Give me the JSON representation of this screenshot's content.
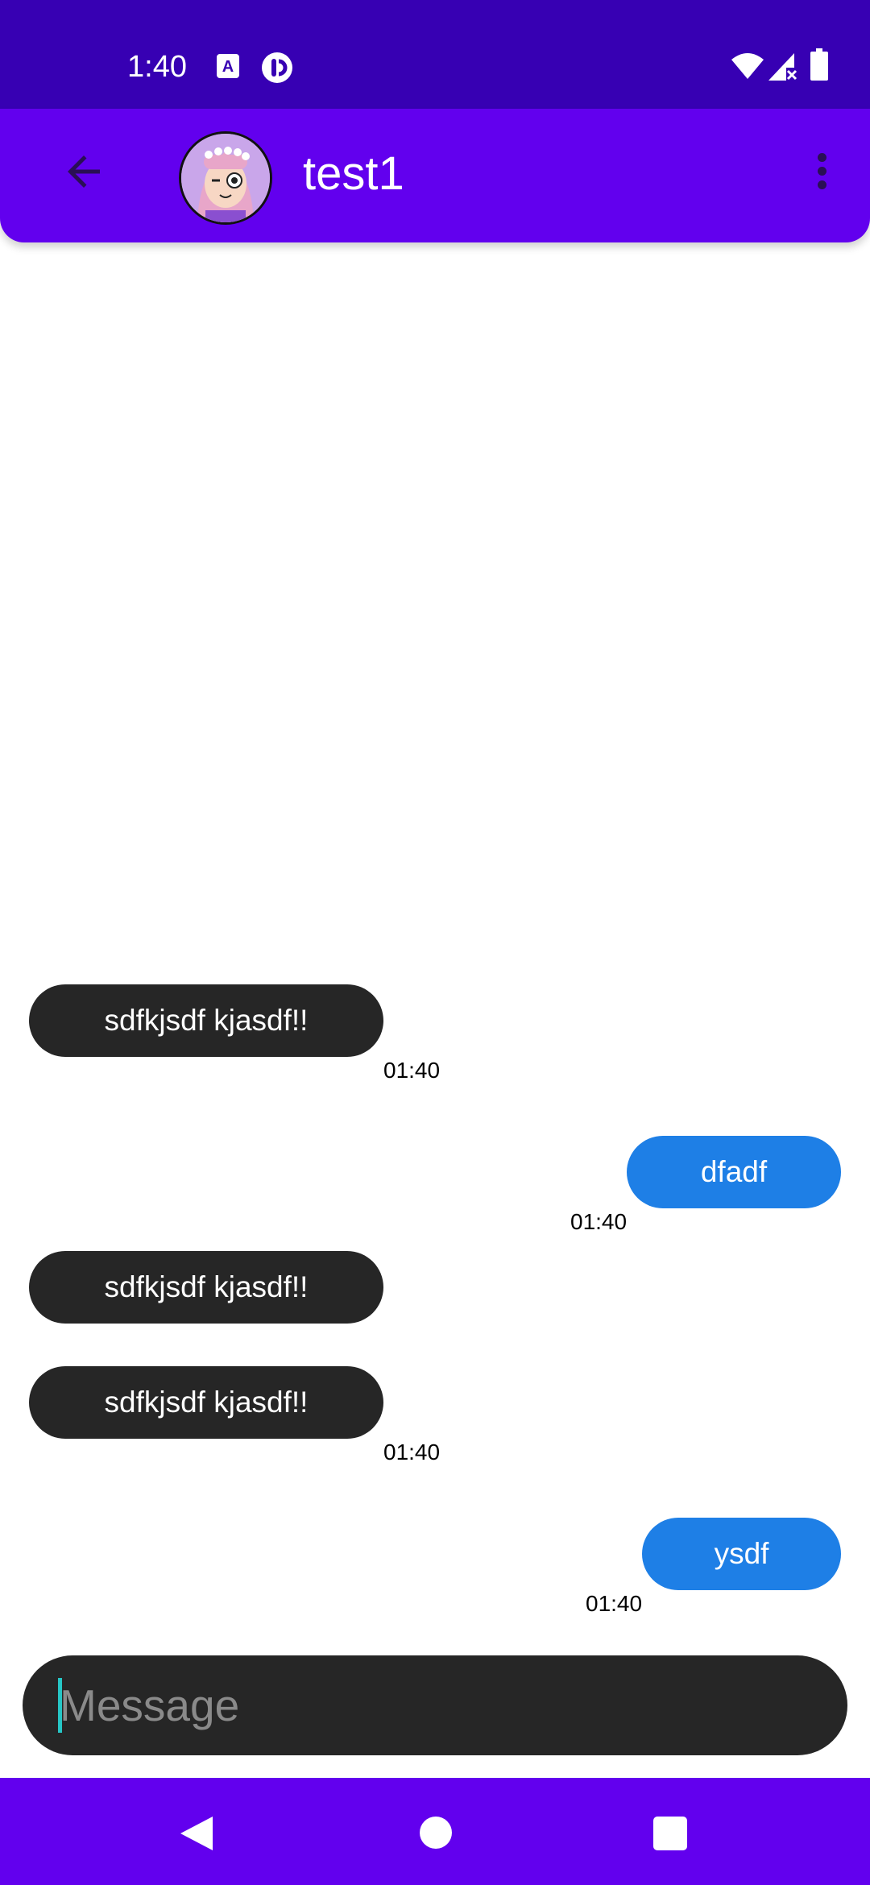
{
  "status_bar": {
    "time": "1:40",
    "icons": [
      "translate-notification-icon",
      "app-notification-icon",
      "wifi-icon",
      "signal-icon",
      "battery-icon"
    ]
  },
  "app_bar": {
    "back_icon": "arrow-back-icon",
    "avatar_icon": "contact-avatar",
    "title": "test1",
    "more_icon": "more-vert-icon",
    "color": "#6200ee"
  },
  "messages": [
    {
      "direction": "incoming",
      "text": "sdfkjsdf kjasdf!!",
      "time": "01:40"
    },
    {
      "direction": "outgoing",
      "text": "dfadf",
      "time": "01:40"
    },
    {
      "direction": "incoming",
      "text": "sdfkjsdf kjasdf!!",
      "time": ""
    },
    {
      "direction": "incoming",
      "text": "sdfkjsdf kjasdf!!",
      "time": "01:40"
    },
    {
      "direction": "outgoing",
      "text": "ysdf",
      "time": "01:40"
    }
  ],
  "composer": {
    "placeholder": "Message",
    "value": ""
  },
  "nav_bar": {
    "icons": [
      "nav-back-icon",
      "nav-home-icon",
      "nav-recents-icon"
    ]
  },
  "colors": {
    "status_bar": "#3700b3",
    "primary": "#6200ee",
    "incoming_bubble": "#262626",
    "outgoing_bubble": "#1e7fe6"
  }
}
